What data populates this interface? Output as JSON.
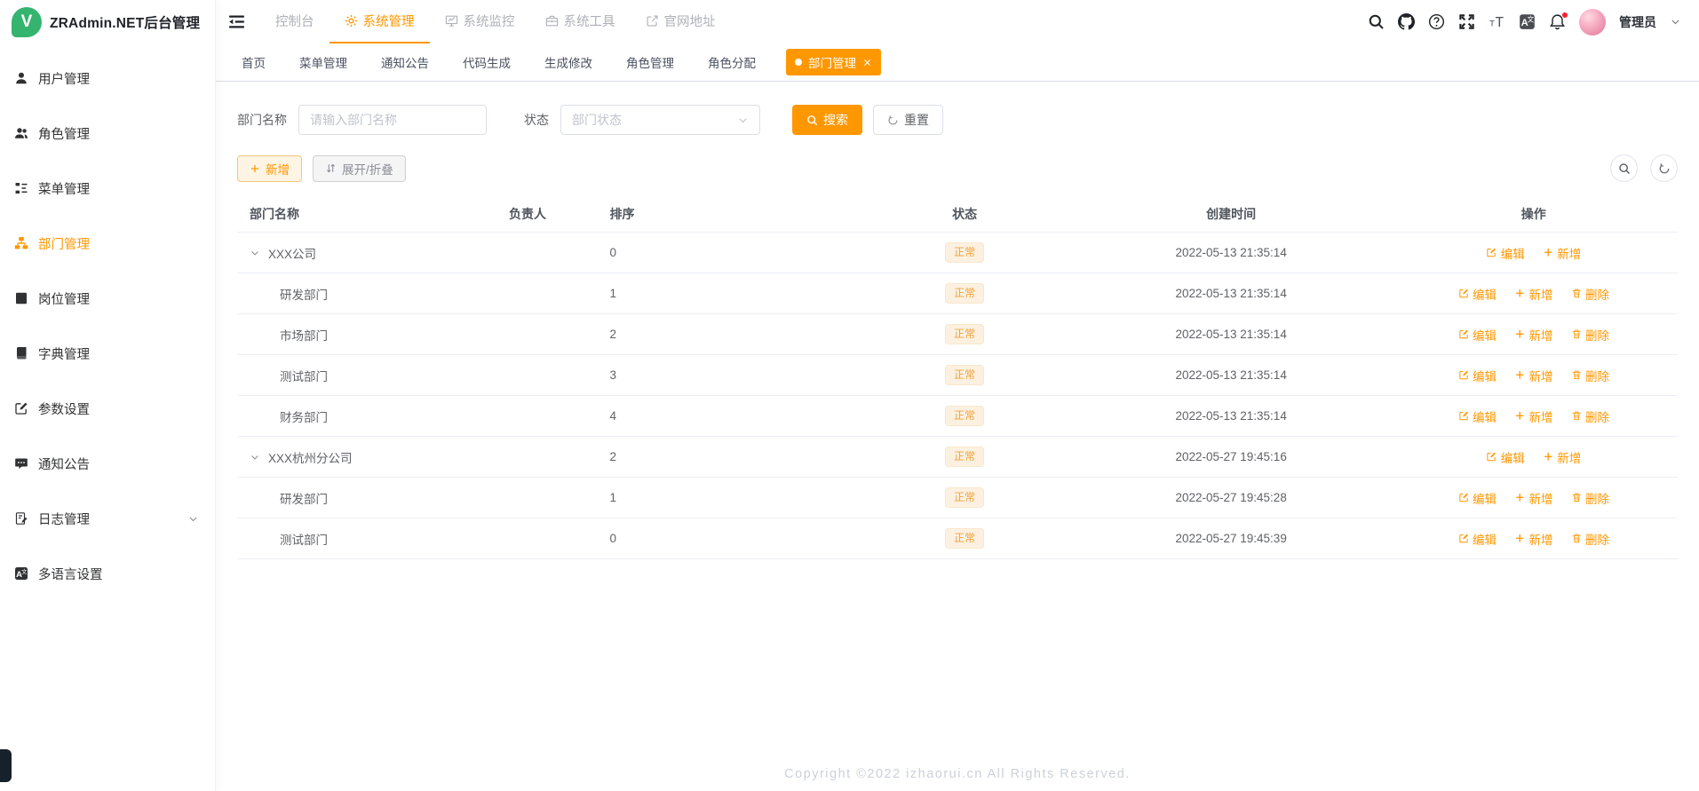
{
  "app": {
    "title": "ZRAdmin.NET后台管理",
    "logo_letter": "V"
  },
  "sidebar": {
    "items": [
      {
        "label": "用户管理",
        "icon": "user-icon",
        "active": false
      },
      {
        "label": "角色管理",
        "icon": "users-icon",
        "active": false
      },
      {
        "label": "菜单管理",
        "icon": "menu-tree-icon",
        "active": false
      },
      {
        "label": "部门管理",
        "icon": "org-chart-icon",
        "active": true
      },
      {
        "label": "岗位管理",
        "icon": "badge-icon",
        "active": false
      },
      {
        "label": "字典管理",
        "icon": "dictionary-icon",
        "active": false
      },
      {
        "label": "参数设置",
        "icon": "edit-settings-icon",
        "active": false
      },
      {
        "label": "通知公告",
        "icon": "message-icon",
        "active": false
      },
      {
        "label": "日志管理",
        "icon": "log-icon",
        "active": false,
        "has_children": true
      },
      {
        "label": "多语言设置",
        "icon": "translate-icon",
        "active": false
      }
    ]
  },
  "header": {
    "nav": [
      {
        "label": "控制台",
        "icon": "",
        "active": false
      },
      {
        "label": "系统管理",
        "icon": "gear-icon",
        "active": true
      },
      {
        "label": "系统监控",
        "icon": "monitor-icon",
        "active": false
      },
      {
        "label": "系统工具",
        "icon": "toolbox-icon",
        "active": false
      },
      {
        "label": "官网地址",
        "icon": "external-link-icon",
        "active": false
      }
    ],
    "user": {
      "name": "管理员"
    }
  },
  "tabs": [
    {
      "label": "首页",
      "active": false
    },
    {
      "label": "菜单管理",
      "active": false
    },
    {
      "label": "通知公告",
      "active": false
    },
    {
      "label": "代码生成",
      "active": false
    },
    {
      "label": "生成修改",
      "active": false
    },
    {
      "label": "角色管理",
      "active": false
    },
    {
      "label": "角色分配",
      "active": false
    },
    {
      "label": "部门管理",
      "active": true
    }
  ],
  "filters": {
    "dept_name_label": "部门名称",
    "dept_name_placeholder": "请输入部门名称",
    "dept_name_value": "",
    "status_label": "状态",
    "status_placeholder": "部门状态",
    "search_label": "搜索",
    "reset_label": "重置"
  },
  "toolbar": {
    "add_label": "新增",
    "expand_label": "展开/折叠"
  },
  "table": {
    "columns": [
      "部门名称",
      "负责人",
      "排序",
      "状态",
      "创建时间",
      "操作"
    ],
    "action_labels": {
      "edit": "编辑",
      "add": "新增",
      "delete": "删除"
    },
    "rows": [
      {
        "name": "XXX公司",
        "leader": "",
        "order": "0",
        "status": "正常",
        "created": "2022-05-13 21:35:14",
        "is_parent": true
      },
      {
        "name": "研发部门",
        "leader": "",
        "order": "1",
        "status": "正常",
        "created": "2022-05-13 21:35:14",
        "is_parent": false
      },
      {
        "name": "市场部门",
        "leader": "",
        "order": "2",
        "status": "正常",
        "created": "2022-05-13 21:35:14",
        "is_parent": false
      },
      {
        "name": "测试部门",
        "leader": "",
        "order": "3",
        "status": "正常",
        "created": "2022-05-13 21:35:14",
        "is_parent": false
      },
      {
        "name": "财务部门",
        "leader": "",
        "order": "4",
        "status": "正常",
        "created": "2022-05-13 21:35:14",
        "is_parent": false
      },
      {
        "name": "XXX杭州分公司",
        "leader": "",
        "order": "2",
        "status": "正常",
        "created": "2022-05-27 19:45:16",
        "is_parent": true
      },
      {
        "name": "研发部门",
        "leader": "",
        "order": "1",
        "status": "正常",
        "created": "2022-05-27 19:45:28",
        "is_parent": false
      },
      {
        "name": "测试部门",
        "leader": "",
        "order": "0",
        "status": "正常",
        "created": "2022-05-27 19:45:39",
        "is_parent": false
      }
    ]
  },
  "footer": {
    "copyright": "Copyright ©2022 izhaorui.cn All Rights Reserved."
  },
  "colors": {
    "accent": "#ff9700",
    "logo_green": "#35b46f",
    "badge_bg": "#fcf1e1",
    "badge_text": "#f0a23c",
    "notification_dot": "#f5222d"
  }
}
